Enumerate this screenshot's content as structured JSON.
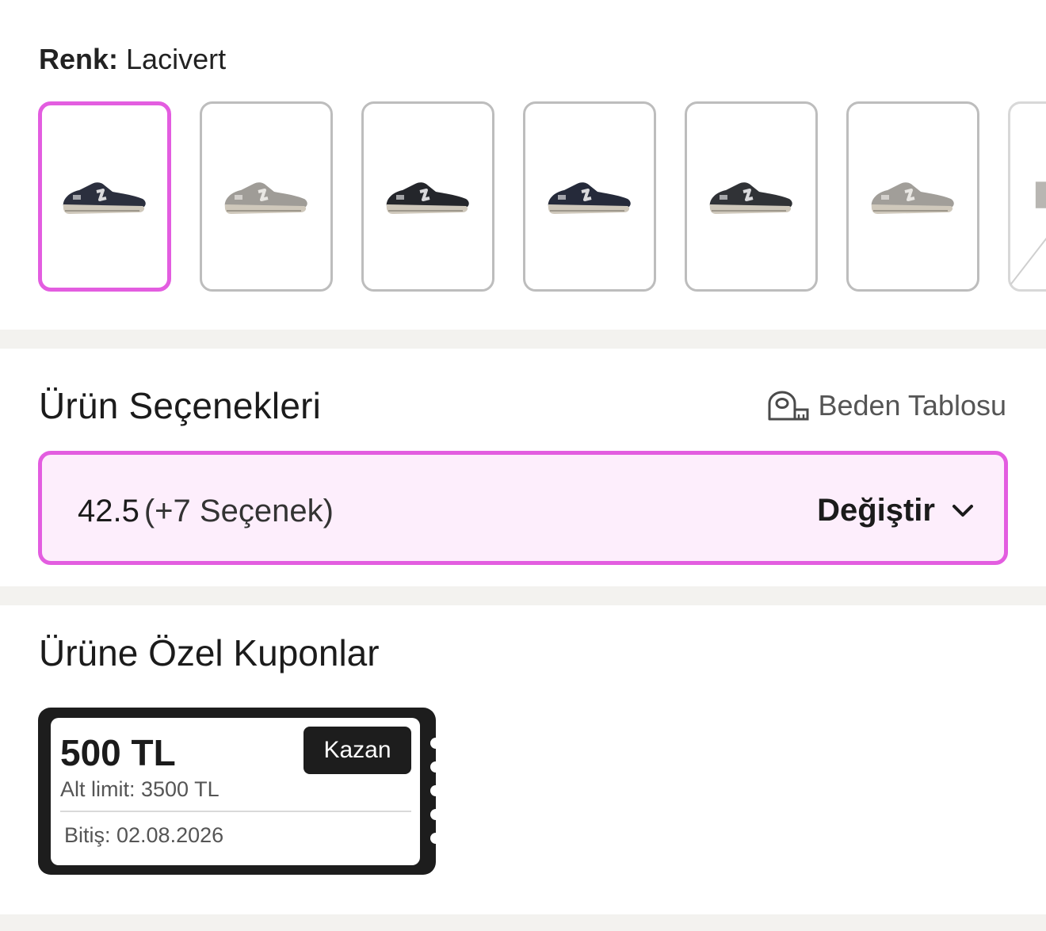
{
  "color": {
    "label": "Renk:",
    "value": "Lacivert",
    "swatches": [
      {
        "name": "navy",
        "color": "#2b2f3e",
        "selected": true
      },
      {
        "name": "grey",
        "color": "#9f9c97",
        "selected": false
      },
      {
        "name": "black",
        "color": "#24262b",
        "selected": false
      },
      {
        "name": "navy-2",
        "color": "#252a3a",
        "selected": false
      },
      {
        "name": "dark-grey",
        "color": "#303236",
        "selected": false
      },
      {
        "name": "light-grey",
        "color": "#a19e99",
        "selected": false
      }
    ],
    "selected_border": "#e35de0"
  },
  "options": {
    "title": "Ürün Seçenekleri",
    "size_chart_label": "Beden Tablosu",
    "selected_size": "42.5",
    "more_options": "(+7 Seçenek)",
    "change_label": "Değiştir"
  },
  "coupons": {
    "title": "Ürüne Özel Kuponlar",
    "items": [
      {
        "amount": "500 TL",
        "action": "Kazan",
        "min_limit": "Alt limit: 3500 TL",
        "expiry": "Bitiş: 02.08.2026"
      }
    ]
  },
  "icons": [
    "tape-measure-icon",
    "chevron-down-icon"
  ]
}
